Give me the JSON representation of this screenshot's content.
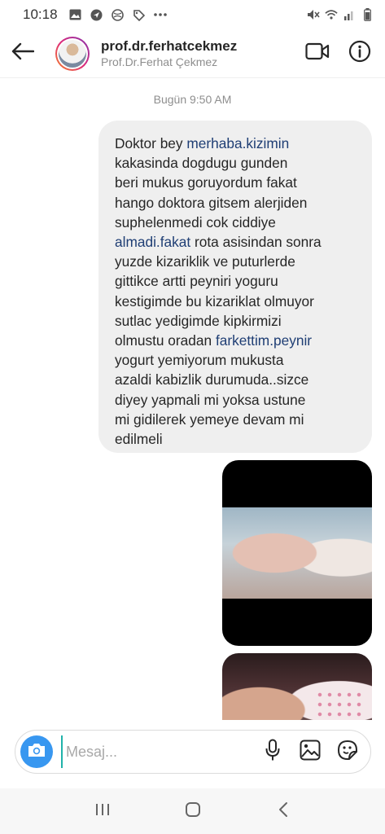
{
  "status_bar": {
    "time": "10:18",
    "left_icons": [
      "image-icon",
      "location-icon",
      "globe-icon",
      "tag-icon",
      "more-dots-icon"
    ],
    "right_icons": [
      "mute-icon",
      "wifi-icon",
      "signal-icon",
      "battery-icon"
    ]
  },
  "header": {
    "username": "prof.dr.ferhatcekmez",
    "full_name": "Prof.Dr.Ferhat Çekmez",
    "icons": {
      "back": "arrow-left-icon",
      "video": "video-call-icon",
      "info": "info-icon"
    }
  },
  "chat": {
    "timestamp": "Bugün 9:50 AM",
    "message": {
      "parts": [
        "Doktor bey ",
        "merhaba.kizimin",
        "\nkakasinda dogdugu gunden\nberi mukus goruyordum fakat\nhango doktora gitsem alerjiden\nsuphelenmedi cok ciddiye\n",
        "almadi.fakat",
        " rota asisindan sonra\nyuzde kizariklik ve puturlerde\ngittikce artti peyniri yoguru\nkestigimde bu kizariklat olmuyor\nsutlac yedigimde kipkirmizi\nolmustu oradan ",
        "farkettim.peynir",
        "\nyogurt yemiyorum mukusta\nazaldi kabizlik durumuda..sizce\ndiyey yapmali mi yoksa ustune\nmi gidilerek yemeye devam mi\nedilmeli"
      ]
    },
    "attachments": [
      {
        "type": "photo",
        "name": "baby-photo-1"
      },
      {
        "type": "photo",
        "name": "baby-photo-2"
      }
    ]
  },
  "composer": {
    "placeholder": "Mesaj...",
    "value": "",
    "icons": {
      "camera": "camera-icon",
      "mic": "microphone-icon",
      "gallery": "gallery-icon",
      "sticker": "sticker-icon"
    }
  },
  "navbar": {
    "icons": [
      "recent-apps-icon",
      "home-icon",
      "back-icon"
    ]
  },
  "colors": {
    "accent": "#3897f0",
    "bubble": "#efefef",
    "link": "#1f3e74",
    "secondary_text": "#8e8e8e"
  }
}
